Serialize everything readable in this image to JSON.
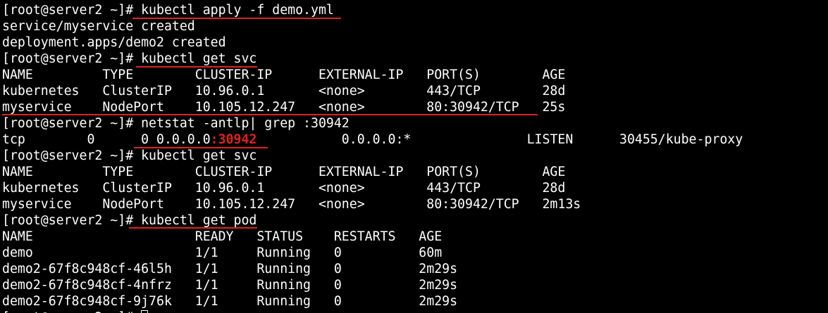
{
  "colors": {
    "background": "#000000",
    "text": "#ffffff",
    "annotation": "#e0221f"
  },
  "terminal": {
    "prompt": "[root@server2 ~]#",
    "lines": [
      " kubectl apply -f demo.yml",
      "service/myservice created",
      "deployment.apps/demo2 created",
      " kubectl get svc",
      "NAME         TYPE        CLUSTER-IP      EXTERNAL-IP   PORT(S)        AGE",
      "kubernetes   ClusterIP   10.96.0.1       <none>        443/TCP        28d",
      "myservice    NodePort    10.105.12.247   <none>        80:30942/TCP   25s",
      " netstat -antlp| grep :30942",
      "tcp        0      0 0.0.0.0",
      ":30942",
      "           0.0.0.0:*               LISTEN      30455/kube-proxy",
      " kubectl get svc",
      "NAME         TYPE        CLUSTER-IP      EXTERNAL-IP   PORT(S)        AGE",
      "kubernetes   ClusterIP   10.96.0.1       <none>        443/TCP        28d",
      "myservice    NodePort    10.105.12.247   <none>        80:30942/TCP   2m13s",
      " kubectl get pod",
      "NAME                     READY   STATUS    RESTARTS   AGE",
      "demo                     1/1     Running   0          60m",
      "demo2-67f8c948cf-46l5h   1/1     Running   0          2m29s",
      "demo2-67f8c948cf-4nfrz   1/1     Running   0          2m29s",
      "demo2-67f8c948cf-9j76k   1/1     Running   0          2m29s"
    ]
  }
}
